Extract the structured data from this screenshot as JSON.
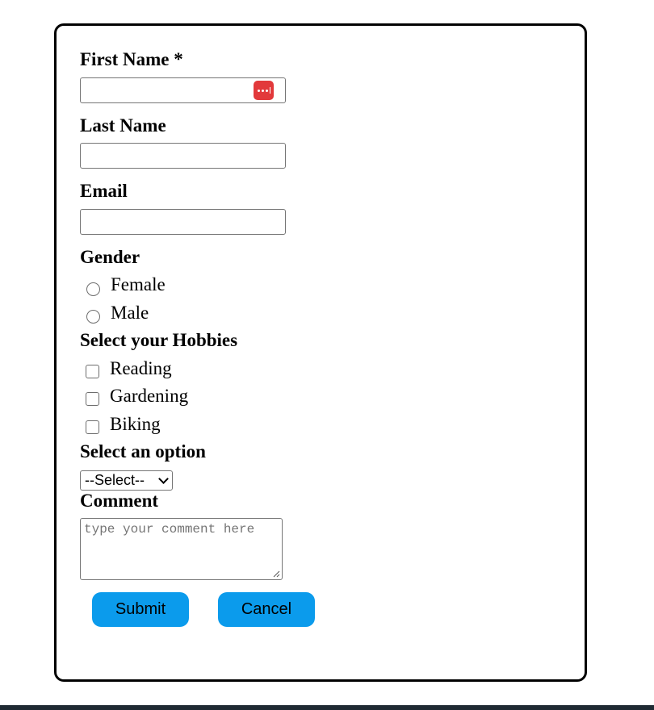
{
  "form": {
    "first_name": {
      "label": "First Name *",
      "value": ""
    },
    "last_name": {
      "label": "Last Name",
      "value": ""
    },
    "email": {
      "label": "Email",
      "value": ""
    },
    "gender": {
      "label": "Gender",
      "options": [
        "Female",
        "Male"
      ]
    },
    "hobbies": {
      "label": "Select your Hobbies",
      "options": [
        "Reading",
        "Gardening",
        "Biking"
      ]
    },
    "select": {
      "label": "Select an option",
      "selected": "--Select--"
    },
    "comment": {
      "label": "Comment",
      "placeholder": "type your comment here"
    },
    "buttons": {
      "submit": "Submit",
      "cancel": "Cancel"
    }
  },
  "colors": {
    "button_bg": "#0b9bec",
    "password_manager_icon": "#e2393b",
    "card_border": "#000000"
  },
  "icons": {
    "password_manager": "password-manager-icon",
    "select_chevron": "chevron-down-icon",
    "resize_grip": "resize-grip-icon"
  }
}
